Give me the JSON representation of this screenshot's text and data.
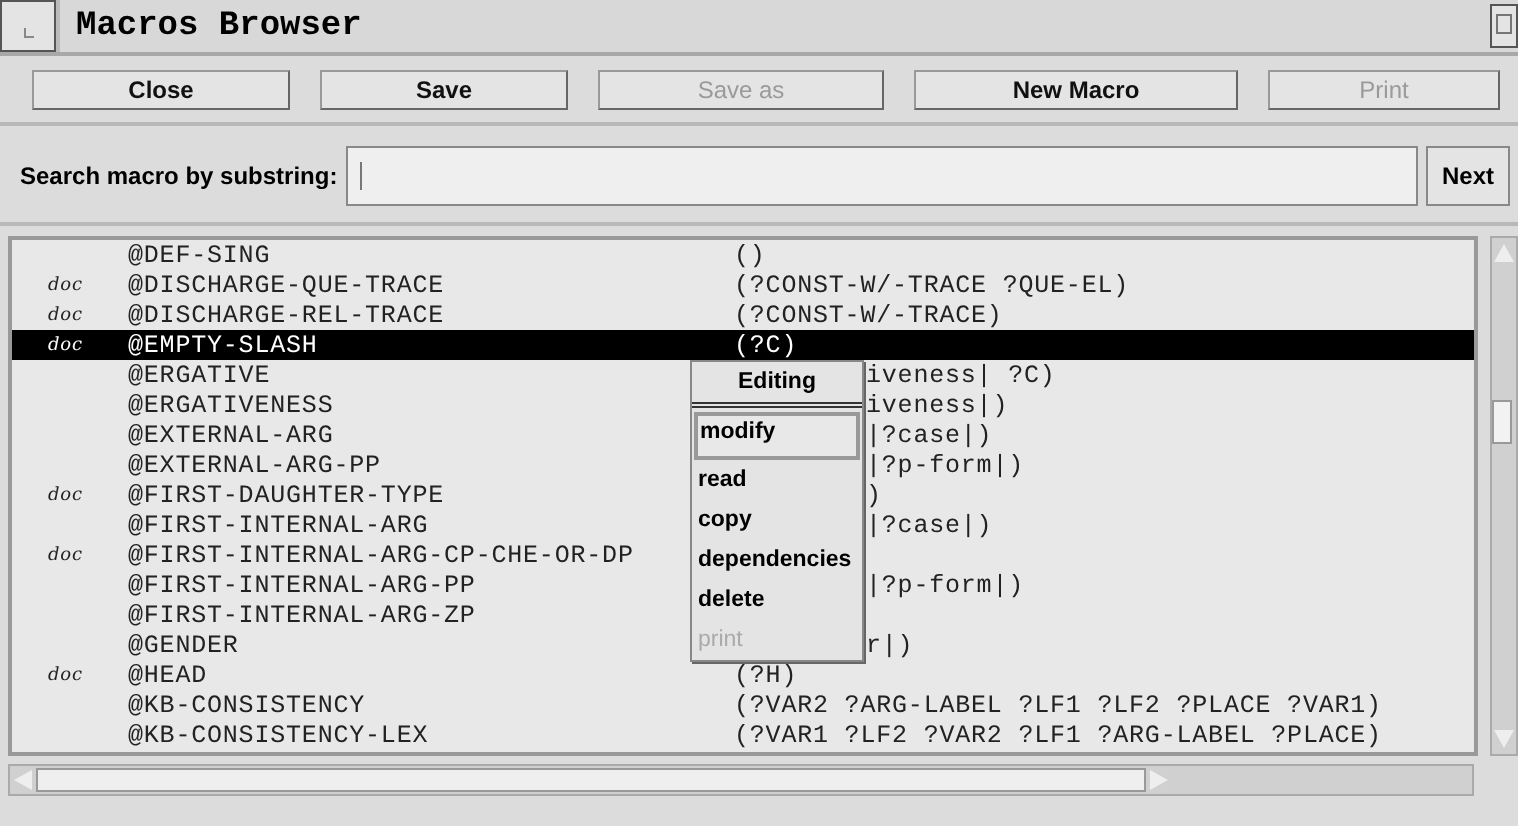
{
  "window": {
    "title": "Macros Browser"
  },
  "buttons": [
    {
      "label": "Close",
      "disabled": false
    },
    {
      "label": "Save",
      "disabled": false
    },
    {
      "label": "Save as",
      "disabled": true
    },
    {
      "label": "New Macro",
      "disabled": false
    },
    {
      "label": "Print",
      "disabled": true
    }
  ],
  "search": {
    "label": "Search macro by substring:",
    "button": "Next"
  },
  "macros": [
    {
      "name": "@DEF-SING",
      "args": "()",
      "selected": false
    },
    {
      "doc": "doc",
      "name": "@DISCHARGE-QUE-TRACE",
      "args": "(?CONST-W/-TRACE ?QUE-EL)",
      "selected": false
    },
    {
      "doc": "doc",
      "name": "@DISCHARGE-REL-TRACE",
      "args": "(?CONST-W/-TRACE)",
      "selected": false
    },
    {
      "doc": "doc",
      "name": "@EMPTY-SLASH",
      "args": "(?C)",
      "selected": true
    },
    {
      "name": "@ERGATIVE",
      "args": "iveness| ?C)",
      "selected": false
    },
    {
      "name": "@ERGATIVENESS",
      "args": "iveness|)",
      "selected": false
    },
    {
      "name": "@EXTERNAL-ARG",
      "args": "|?case|)",
      "selected": false
    },
    {
      "name": "@EXTERNAL-ARG-PP",
      "args": "|?p-form|)",
      "selected": false
    },
    {
      "doc": "doc",
      "name": "@FIRST-DAUGHTER-TYPE",
      "args": ")",
      "selected": false
    },
    {
      "name": "@FIRST-INTERNAL-ARG",
      "args": "|?case|)",
      "selected": false
    },
    {
      "doc": "doc",
      "name": "@FIRST-INTERNAL-ARG-CP-CHE-OR-DP",
      "selected": false
    },
    {
      "name": "@FIRST-INTERNAL-ARG-PP",
      "args": "|?p-form|)",
      "selected": false
    },
    {
      "name": "@FIRST-INTERNAL-ARG-ZP",
      "selected": false
    },
    {
      "name": "@GENDER",
      "args": "r|)",
      "selected": false
    },
    {
      "doc": "doc",
      "name": "@HEAD",
      "args": "(?H)",
      "selected": false
    },
    {
      "name": "@KB-CONSISTENCY",
      "args": "(?VAR2 ?ARG-LABEL ?LF1 ?LF2 ?PLACE ?VAR1)",
      "selected": false
    },
    {
      "name": "@KB-CONSISTENCY-LEX",
      "args": "(?VAR1 ?LF2 ?VAR2 ?LF1 ?ARG-LABEL ?PLACE)",
      "selected": false
    }
  ],
  "context_menu": {
    "title": "Editing",
    "items": [
      {
        "label": "modify",
        "selected": true,
        "disabled": false
      },
      {
        "label": "read",
        "selected": false,
        "disabled": false
      },
      {
        "label": "copy",
        "selected": false,
        "disabled": false
      },
      {
        "label": "dependencies",
        "selected": false,
        "disabled": false
      },
      {
        "label": "delete",
        "selected": false,
        "disabled": false
      },
      {
        "label": "print",
        "selected": false,
        "disabled": true
      }
    ]
  }
}
